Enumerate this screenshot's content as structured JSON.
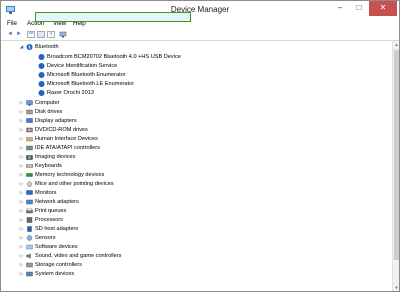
{
  "window": {
    "title": "Device Manager",
    "controls": {
      "minimize": "–",
      "maximize": "□",
      "close": "✕"
    }
  },
  "menu": {
    "file": "File",
    "action": "Action",
    "view": "View",
    "help": "Help"
  },
  "toolbar": {
    "back": "◄",
    "forward": "►"
  },
  "tree": {
    "bluetooth": {
      "label": "Bluetooth",
      "children": [
        "Broadcom BCM20702 Bluetooth 4.0 +HS USB Device",
        "Device Identification Service",
        "Microsoft Bluetooth Enumerator",
        "Microsoft Bluetooth LE Enumerator",
        "Razer Orochi 2013"
      ]
    },
    "categories": [
      "Computer",
      "Disk drives",
      "Display adapters",
      "DVD/CD-ROM drives",
      "Human Interface Devices",
      "IDE ATA/ATAPI controllers",
      "Imaging devices",
      "Keyboards",
      "Memory technology devices",
      "Mice and other pointing devices",
      "Monitors",
      "Network adapters",
      "Print queues",
      "Processors",
      "SD host adapters",
      "Sensors",
      "Software devices",
      "Sound, video and game controllers",
      "Storage controllers",
      "System devices"
    ]
  },
  "colors": {
    "selection_border": "#3b9a1a",
    "bluetooth_icon": "#1f62c9"
  }
}
